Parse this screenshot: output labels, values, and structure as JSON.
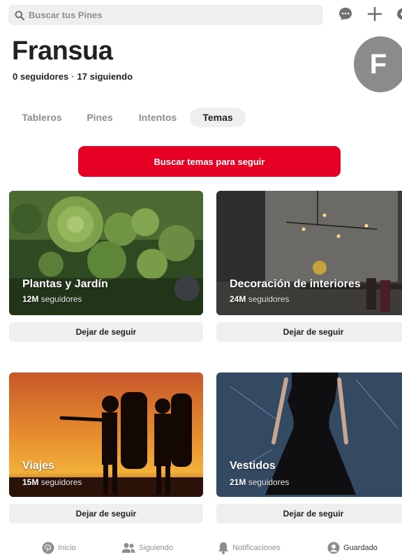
{
  "header": {
    "search_placeholder": "Buscar tus Pines",
    "icons": [
      "search-icon",
      "message-icon",
      "plus-icon",
      "settings-icon"
    ]
  },
  "profile": {
    "name": "Fransua",
    "followers": "0 seguidores",
    "separator": "·",
    "following": "17 siguiendo",
    "avatar_letter": "F"
  },
  "tabs": [
    {
      "label": "Tableros",
      "active": false
    },
    {
      "label": "Pines",
      "active": false
    },
    {
      "label": "Intentos",
      "active": false
    },
    {
      "label": "Temas",
      "active": true
    }
  ],
  "cta_label": "Buscar temas para seguir",
  "topics": [
    {
      "title": "Plantas y Jardín",
      "count": "12M",
      "suffix": "seguidores",
      "button": "Dejar de seguir"
    },
    {
      "title": "Decoración de interiores",
      "count": "24M",
      "suffix": "seguidores",
      "button": "Dejar de seguir"
    },
    {
      "title": "Viajes",
      "count": "15M",
      "suffix": "seguidores",
      "button": "Dejar de seguir"
    },
    {
      "title": "Vestidos",
      "count": "21M",
      "suffix": "seguidores",
      "button": "Dejar de seguir"
    }
  ],
  "bottom_nav": [
    {
      "label": "Inicio",
      "icon": "pinterest-icon",
      "active": false
    },
    {
      "label": "Siguiendo",
      "icon": "people-icon",
      "active": false
    },
    {
      "label": "Notificaciones",
      "icon": "bell-icon",
      "active": false
    },
    {
      "label": "Guardado",
      "icon": "profile-icon",
      "active": true
    }
  ],
  "colors": {
    "accent": "#e60023",
    "muted": "#8e8e8e",
    "chip": "#efefef"
  }
}
